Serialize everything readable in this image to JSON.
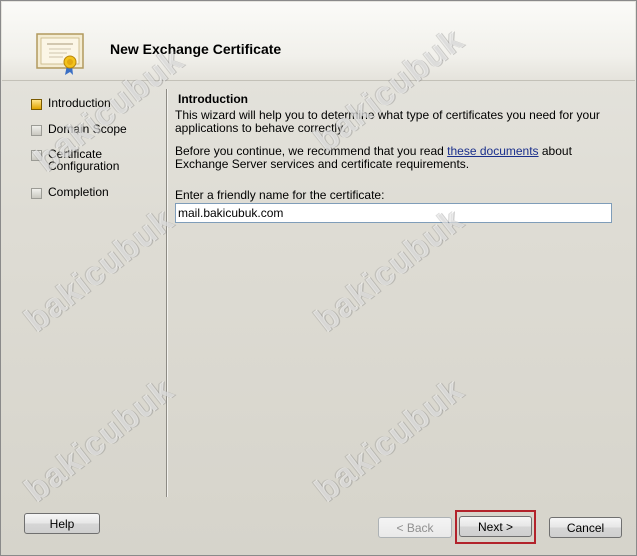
{
  "wizard": {
    "title": "New Exchange Certificate"
  },
  "steps": [
    {
      "label": "Introduction",
      "state": "active"
    },
    {
      "label": "Domain Scope",
      "state": "pending"
    },
    {
      "label": "Certificate\nConfiguration",
      "state": "pending"
    },
    {
      "label": "Completion",
      "state": "pending"
    }
  ],
  "intro": {
    "heading": "Introduction",
    "para1": "This wizard will help you to determine what type of certificates you need for your applications to behave correctly.",
    "para2_before": "Before you continue, we recommend that you read ",
    "para2_link": "these documents",
    "para2_after": " about Exchange Server services and certificate requirements.",
    "friendly_name_label": "Enter a friendly name for the certificate:",
    "friendly_name_value": "mail.bakicubuk.com"
  },
  "buttons": {
    "help": "Help",
    "back": "< Back",
    "next": "Next >",
    "cancel": "Cancel"
  },
  "watermark": "bakicubuk",
  "colors": {
    "active_step": "#e0a400",
    "link": "#1a2f8c",
    "highlight": "#b2232b"
  }
}
